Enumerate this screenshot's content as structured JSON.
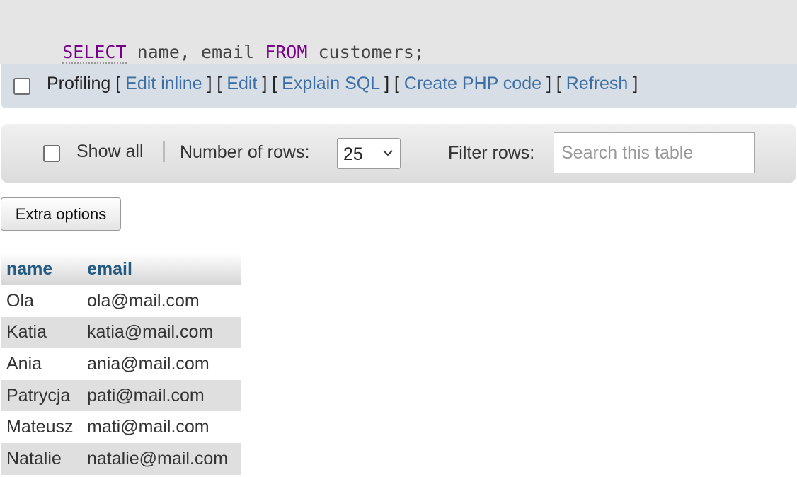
{
  "sql": {
    "tokens": [
      {
        "text": "SELECT",
        "type": "keyword"
      },
      {
        "text": " name, email ",
        "type": "text"
      },
      {
        "text": "FROM",
        "type": "keyword"
      },
      {
        "text": " customers;",
        "type": "text"
      }
    ]
  },
  "query_tools": {
    "profiling_label": "Profiling",
    "links": [
      "Edit inline",
      "Edit",
      "Explain SQL",
      "Create PHP code",
      "Refresh"
    ]
  },
  "navigation": {
    "show_all_label": "Show all",
    "rows_label": "Number of rows:",
    "rows_value": "25",
    "filter_label": "Filter rows:",
    "filter_placeholder": "Search this table",
    "filter_value": ""
  },
  "extra_options_label": "Extra options",
  "results": {
    "columns": [
      "name",
      "email"
    ],
    "rows": [
      [
        "Ola",
        "ola@mail.com"
      ],
      [
        "Katia",
        "katia@mail.com"
      ],
      [
        "Ania",
        "ania@mail.com"
      ],
      [
        "Patrycja",
        "pati@mail.com"
      ],
      [
        "Mateusz",
        "mati@mail.com"
      ],
      [
        "Natalie",
        "natalie@mail.com"
      ]
    ]
  },
  "colors": {
    "link": "#3d6fa5",
    "keyword": "#770088",
    "header_text": "#235a81"
  }
}
